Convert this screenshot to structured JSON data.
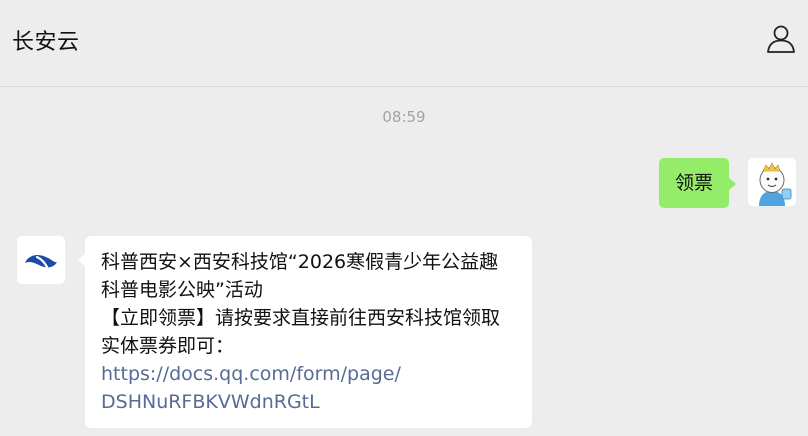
{
  "header": {
    "title": "长安云",
    "profile_icon": "person-outline-icon"
  },
  "chat": {
    "timestamp": "08:59",
    "outgoing_message": "领票",
    "incoming_message": {
      "lines": [
        "科普西安×西安科技馆“2026寒假青少年公益趣",
        "科普电影公映”活动",
        "【立即领票】请按要求直接前往西安科技馆领取",
        "实体票券即可："
      ],
      "link_lines": [
        "https://docs.qq.com/form/page/",
        "DSHNuRFBKVWdnRGtL"
      ]
    }
  },
  "colors": {
    "background": "#ededed",
    "outgoing_bubble": "#95ec69",
    "incoming_bubble": "#ffffff",
    "link": "#576b95",
    "timestamp": "#a3a3a3"
  },
  "icons": {
    "my_avatar": "cartoon-avatar-icon",
    "sender_avatar": "changan-cloud-logo-icon"
  }
}
